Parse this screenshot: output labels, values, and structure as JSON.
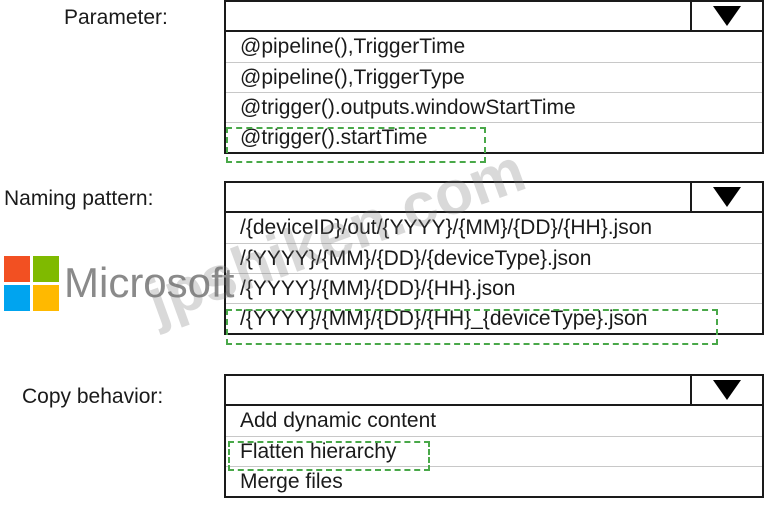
{
  "parameter": {
    "label": "Parameter:",
    "value": "",
    "options": [
      "@pipeline(),TriggerTime",
      "@pipeline(),TriggerType",
      "@trigger().outputs.windowStartTime",
      "@trigger().startTime"
    ],
    "selected_option": "@trigger().startTime"
  },
  "naming_pattern": {
    "label": "Naming pattern:",
    "value": "",
    "options": [
      "/{deviceID}/out/{YYYY}/{MM}/{DD}/{HH}.json",
      "/{YYYY}/{MM}/{DD}/{deviceType}.json",
      "/{YYYY}/{MM}/{DD}/{HH}.json",
      "/{YYYY}/{MM}/{DD}/{HH}_{deviceType}.json"
    ],
    "selected_option": "/{YYYY}/{MM}/{DD}/{HH}_{deviceType}.json"
  },
  "copy_behavior": {
    "label": "Copy behavior:",
    "value": "",
    "options": [
      "Add dynamic content",
      "Flatten hierarchy",
      "Merge files"
    ],
    "selected_option": "Flatten hierarchy"
  },
  "watermark": {
    "logo_text": "Microsoft",
    "text": "jpshiken.com",
    "logo_colors": [
      "#f25022",
      "#7fba00",
      "#00a4ef",
      "#ffb900"
    ]
  },
  "colors": {
    "selection_outline": "#49a849",
    "border": "#1a1a1a"
  }
}
